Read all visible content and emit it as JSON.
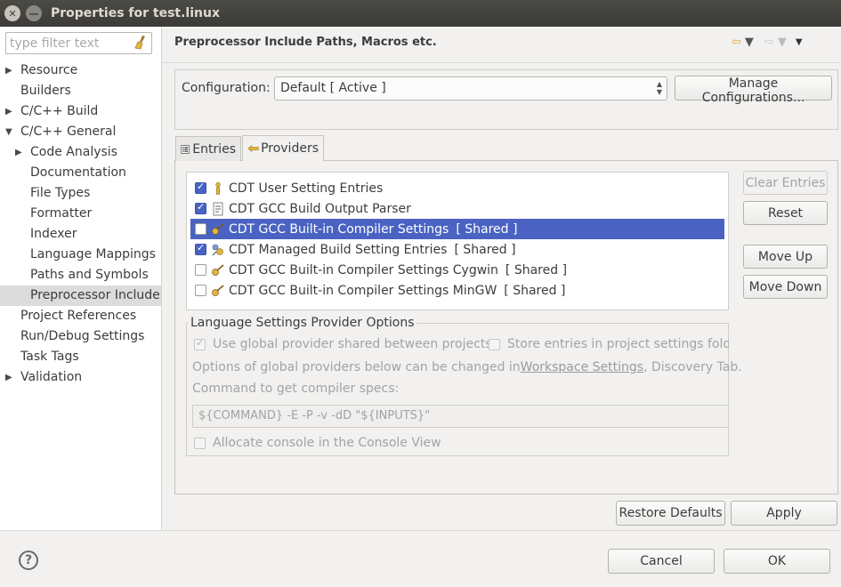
{
  "window": {
    "title": "Properties for test.linux"
  },
  "filter": {
    "placeholder": "type filter text"
  },
  "nav": {
    "items": [
      {
        "label": "Resource",
        "level": 0,
        "expander": "collapsed"
      },
      {
        "label": "Builders",
        "level": 0,
        "expander": "none"
      },
      {
        "label": "C/C++ Build",
        "level": 0,
        "expander": "collapsed"
      },
      {
        "label": "C/C++ General",
        "level": 0,
        "expander": "expanded"
      },
      {
        "label": "Code Analysis",
        "level": 1,
        "expander": "collapsed"
      },
      {
        "label": "Documentation",
        "level": 1,
        "expander": "none"
      },
      {
        "label": "File Types",
        "level": 1,
        "expander": "none"
      },
      {
        "label": "Formatter",
        "level": 1,
        "expander": "none"
      },
      {
        "label": "Indexer",
        "level": 1,
        "expander": "none"
      },
      {
        "label": "Language Mappings",
        "level": 1,
        "expander": "none"
      },
      {
        "label": "Paths and Symbols",
        "level": 1,
        "expander": "none"
      },
      {
        "label": "Preprocessor Include",
        "level": 1,
        "expander": "none",
        "selected": true
      },
      {
        "label": "Project References",
        "level": 0,
        "expander": "none"
      },
      {
        "label": "Run/Debug Settings",
        "level": 0,
        "expander": "none"
      },
      {
        "label": "Task Tags",
        "level": 0,
        "expander": "none"
      },
      {
        "label": "Validation",
        "level": 0,
        "expander": "collapsed"
      }
    ]
  },
  "page": {
    "title": "Preprocessor Include Paths, Macros etc."
  },
  "config": {
    "label": "Configuration:",
    "value": "Default  [ Active ]",
    "manage_label": "Manage Configurations..."
  },
  "tabs": {
    "entries": "Entries",
    "providers": "Providers"
  },
  "providers": [
    {
      "name": "CDT User Setting Entries",
      "shared": "",
      "checked": true,
      "selected": false,
      "icon": "user-settings-icon"
    },
    {
      "name": "CDT GCC Build Output Parser",
      "shared": "",
      "checked": true,
      "selected": false,
      "icon": "build-output-icon"
    },
    {
      "name": "CDT GCC Built-in Compiler Settings",
      "shared": "[ Shared ]",
      "checked": false,
      "selected": true,
      "icon": "compiler-settings-icon"
    },
    {
      "name": "CDT Managed Build Setting Entries",
      "shared": "[ Shared ]",
      "checked": true,
      "selected": false,
      "icon": "managed-build-icon"
    },
    {
      "name": "CDT GCC Built-in Compiler Settings Cygwin",
      "shared": "[ Shared ]",
      "checked": false,
      "selected": false,
      "icon": "compiler-settings-icon"
    },
    {
      "name": "CDT GCC Built-in Compiler Settings MinGW",
      "shared": "[ Shared ]",
      "checked": false,
      "selected": false,
      "icon": "compiler-settings-icon"
    }
  ],
  "side_buttons": {
    "clear": "Clear Entries",
    "reset": "Reset",
    "move_up": "Move Up",
    "move_down": "Move Down"
  },
  "options": {
    "legend": "Language Settings Provider Options",
    "use_global": "Use global provider shared between projects",
    "store_entries": "Store entries in project settings folde",
    "note_prefix": "Options of global providers below can be changed in ",
    "note_link": "Workspace Settings",
    "note_suffix": ", Discovery Tab.",
    "cmd_label": "Command to get compiler specs:",
    "cmd_value": "${COMMAND} -E -P -v -dD \"${INPUTS}\"",
    "allocate_console": "Allocate console in the Console View"
  },
  "bottom": {
    "restore_defaults": "Restore Defaults",
    "apply": "Apply",
    "cancel": "Cancel",
    "ok": "OK",
    "help": "?"
  },
  "colors": {
    "selection": "#4a63c3",
    "titlebar": "#3c3b37",
    "nav_selected": "#dcdcdc"
  }
}
